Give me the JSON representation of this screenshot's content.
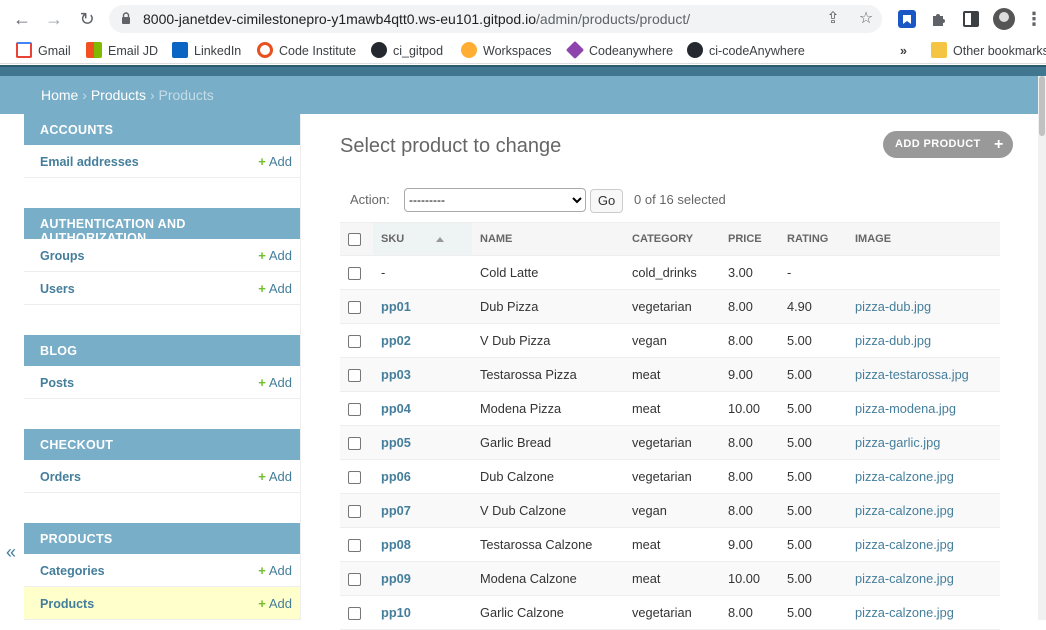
{
  "browser": {
    "url_host": "8000-janetdev-cimilestonepro-y1mawb4qtt0.ws-eu101.gitpod.io",
    "url_path": "/admin/products/product/",
    "bookmarks": [
      {
        "label": "Gmail",
        "icon": "gmail-icon",
        "color": "#ea4335"
      },
      {
        "label": "Email JD",
        "icon": "microsoft-icon",
        "color": "#f25022"
      },
      {
        "label": "LinkedIn",
        "icon": "linkedin-icon",
        "color": "#0a66c2"
      },
      {
        "label": "Code Institute",
        "icon": "code-institute-icon",
        "color": "#e8501f"
      },
      {
        "label": "ci_gitpod",
        "icon": "github-icon",
        "color": "#24292f"
      },
      {
        "label": "Workspaces",
        "icon": "gitpod-icon",
        "color": "#ffae33"
      },
      {
        "label": "Codeanywhere",
        "icon": "codeanywhere-icon",
        "color": "#8e44ad"
      },
      {
        "label": "ci-codeAnywhere",
        "icon": "github-icon",
        "color": "#24292f"
      }
    ],
    "more_bookmarks": "»",
    "other_bookmarks": "Other bookmarks"
  },
  "breadcrumbs": {
    "home": "Home",
    "app": "Products",
    "current": "Products",
    "sep": " › "
  },
  "sidebar": {
    "modules": [
      {
        "header": "Accounts",
        "rows": [
          {
            "name": "Email addresses",
            "add": "Add"
          }
        ]
      },
      {
        "header": "Authentication and Authorization",
        "rows": [
          {
            "name": "Groups",
            "add": "Add"
          },
          {
            "name": "Users",
            "add": "Add"
          }
        ]
      },
      {
        "header": "Blog",
        "rows": [
          {
            "name": "Posts",
            "add": "Add"
          }
        ]
      },
      {
        "header": "Checkout",
        "rows": [
          {
            "name": "Orders",
            "add": "Add"
          }
        ]
      },
      {
        "header": "Products",
        "rows": [
          {
            "name": "Categories",
            "add": "Add"
          },
          {
            "name": "Products",
            "add": "Add",
            "active": true
          }
        ]
      }
    ],
    "collapse": "«"
  },
  "content": {
    "title": "Select product to change",
    "add_button": "ADD PRODUCT",
    "action_label": "Action:",
    "action_selected": "---------",
    "go_label": "Go",
    "selected_count": "0 of 16 selected",
    "columns": [
      "SKU",
      "NAME",
      "CATEGORY",
      "PRICE",
      "RATING",
      "IMAGE"
    ],
    "rows": [
      {
        "sku": "-",
        "name": "Cold Latte",
        "category": "cold_drinks",
        "price": "3.00",
        "rating": "-",
        "image": ""
      },
      {
        "sku": "pp01",
        "name": "Dub Pizza",
        "category": "vegetarian",
        "price": "8.00",
        "rating": "4.90",
        "image": "pizza-dub.jpg"
      },
      {
        "sku": "pp02",
        "name": "V Dub Pizza",
        "category": "vegan",
        "price": "8.00",
        "rating": "5.00",
        "image": "pizza-dub.jpg"
      },
      {
        "sku": "pp03",
        "name": "Testarossa Pizza",
        "category": "meat",
        "price": "9.00",
        "rating": "5.00",
        "image": "pizza-testarossa.jpg"
      },
      {
        "sku": "pp04",
        "name": "Modena Pizza",
        "category": "meat",
        "price": "10.00",
        "rating": "5.00",
        "image": "pizza-modena.jpg"
      },
      {
        "sku": "pp05",
        "name": "Garlic Bread",
        "category": "vegetarian",
        "price": "8.00",
        "rating": "5.00",
        "image": "pizza-garlic.jpg"
      },
      {
        "sku": "pp06",
        "name": "Dub Calzone",
        "category": "vegetarian",
        "price": "8.00",
        "rating": "5.00",
        "image": "pizza-calzone.jpg"
      },
      {
        "sku": "pp07",
        "name": "V Dub Calzone",
        "category": "vegan",
        "price": "8.00",
        "rating": "5.00",
        "image": "pizza-calzone.jpg"
      },
      {
        "sku": "pp08",
        "name": "Testarossa Calzone",
        "category": "meat",
        "price": "9.00",
        "rating": "5.00",
        "image": "pizza-calzone.jpg"
      },
      {
        "sku": "pp09",
        "name": "Modena Calzone",
        "category": "meat",
        "price": "10.00",
        "rating": "5.00",
        "image": "pizza-calzone.jpg"
      },
      {
        "sku": "pp10",
        "name": "Garlic Calzone",
        "category": "vegetarian",
        "price": "8.00",
        "rating": "5.00",
        "image": "pizza-calzone.jpg"
      }
    ]
  }
}
